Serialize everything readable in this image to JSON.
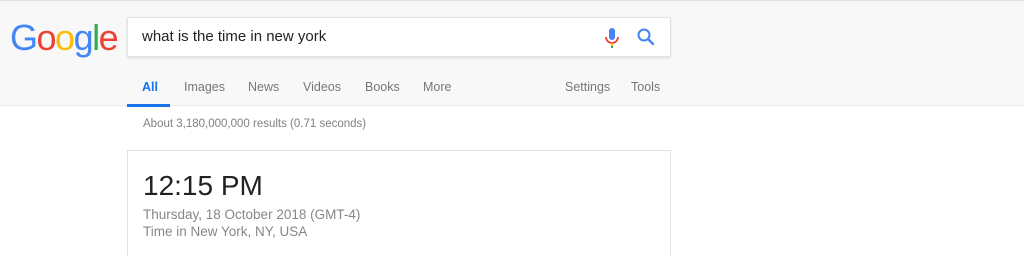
{
  "logo": {
    "letters": [
      "G",
      "o",
      "o",
      "g",
      "l",
      "e"
    ],
    "colors": [
      "#4285f4",
      "#ea4335",
      "#fbbc05",
      "#4285f4",
      "#34a853",
      "#ea4335"
    ]
  },
  "search": {
    "query": "what is the time in new york",
    "mic_icon": "microphone-icon",
    "search_icon": "magnifier-icon",
    "accent": "#4285f4"
  },
  "tabs": {
    "items": [
      {
        "label": "All",
        "active": true
      },
      {
        "label": "Images"
      },
      {
        "label": "News"
      },
      {
        "label": "Videos"
      },
      {
        "label": "Books"
      },
      {
        "label": "More"
      }
    ],
    "settings": "Settings",
    "tools": "Tools"
  },
  "results": {
    "stats": "About 3,180,000,000 results (0.71 seconds)"
  },
  "time_card": {
    "time": "12:15 PM",
    "date": "Thursday, 18 October 2018 (GMT-4)",
    "location": "Time in New York, NY, USA"
  }
}
